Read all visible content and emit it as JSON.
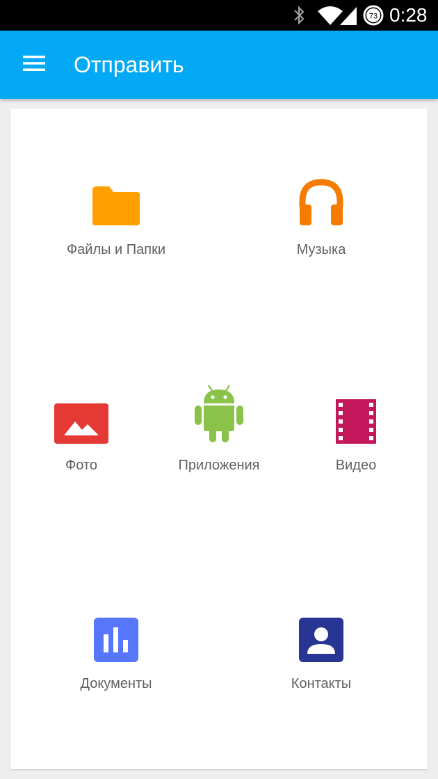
{
  "status_bar": {
    "time": "0:28",
    "battery_level": "73",
    "icons": [
      "bluetooth-icon",
      "wifi-icon",
      "cellular-signal-icon",
      "battery-icon"
    ]
  },
  "app_bar": {
    "title": "Отправить",
    "menu_icon": "hamburger-menu-icon",
    "color": "#03a9f4"
  },
  "categories": [
    {
      "label": "Файлы и Папки",
      "icon": "folder-icon",
      "color": "#ffa000"
    },
    {
      "label": "Музыка",
      "icon": "headphones-icon",
      "color": "#f57c00"
    },
    {
      "label": "Фото",
      "icon": "photo-icon",
      "color": "#e53935"
    },
    {
      "label": "Приложения",
      "icon": "android-icon",
      "color": "#8bc34a"
    },
    {
      "label": "Видео",
      "icon": "film-icon",
      "color": "#c2185b"
    },
    {
      "label": "Документы",
      "icon": "document-chart-icon",
      "color": "#5677fc"
    },
    {
      "label": "Контакты",
      "icon": "contact-icon",
      "color": "#283593"
    }
  ]
}
